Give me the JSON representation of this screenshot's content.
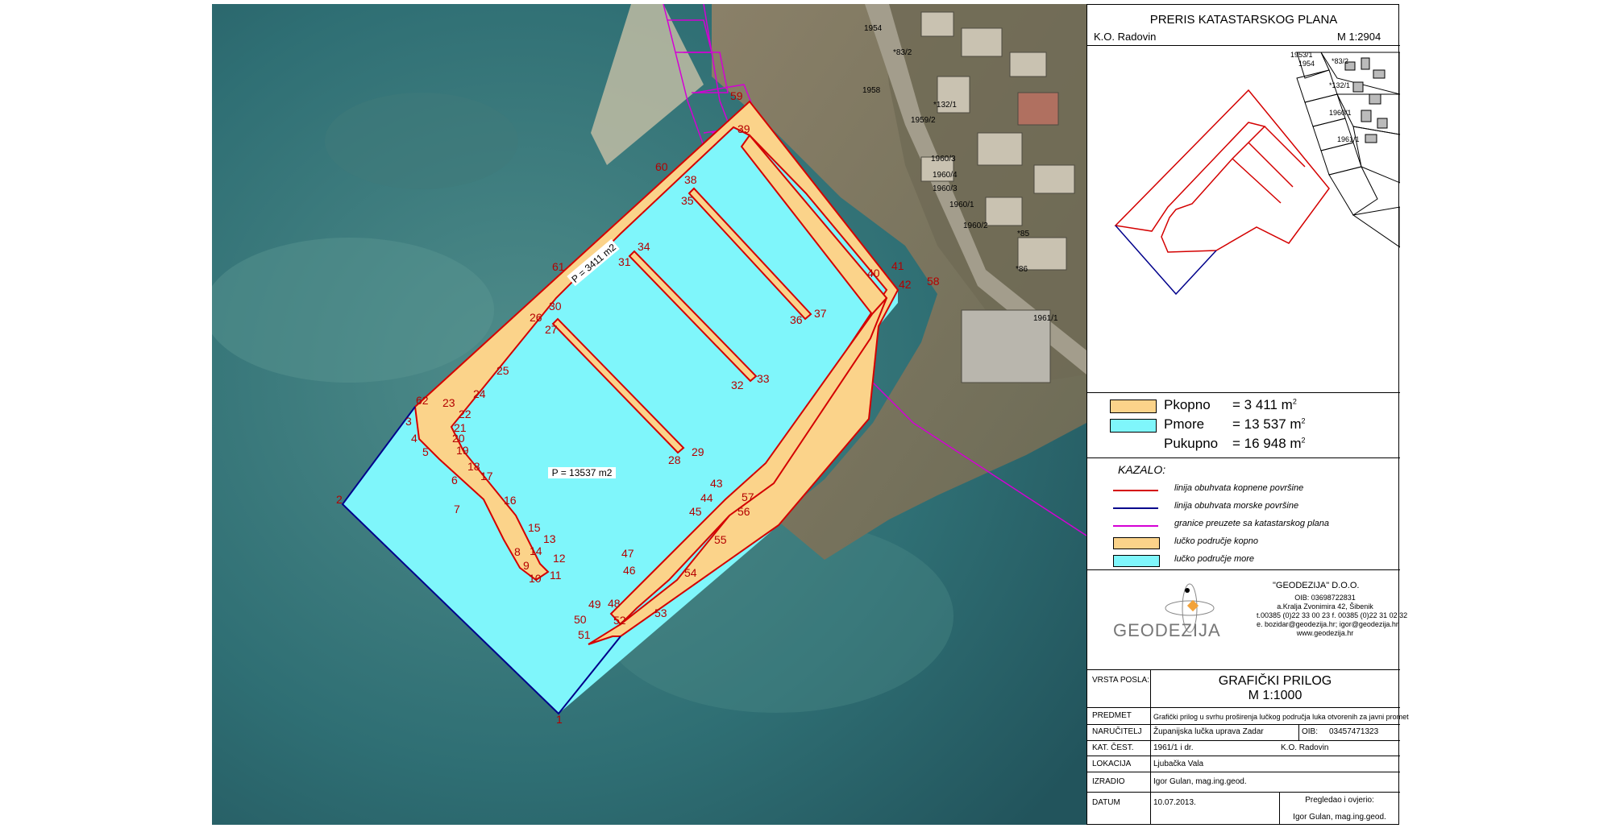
{
  "header": {
    "title": "PRERIS KATASTARSKOG PLANA",
    "ko": "K.O. Radovin",
    "scale": "M 1:2904"
  },
  "areas": [
    {
      "label": "Pkopno",
      "value": "=  3 411 m",
      "sup": "2",
      "color": "#fbd38a"
    },
    {
      "label": "Pmore",
      "value": "= 13 537 m",
      "sup": "2",
      "color": "#7ff6fb"
    },
    {
      "label": "Pukupno",
      "value": "= 16 948 m",
      "sup": "2"
    }
  ],
  "legend": {
    "title": "KAZALO:",
    "items": [
      {
        "kind": "line",
        "color": "#d40000",
        "label": "linija obuhvata kopnene površine"
      },
      {
        "kind": "line",
        "color": "#00008b",
        "label": "linija obuhvata morske površine"
      },
      {
        "kind": "line",
        "color": "#d400d4",
        "label": "granice preuzete sa katastarskog plana"
      },
      {
        "kind": "box",
        "color": "#fbd38a",
        "label": "lučko područje kopno"
      },
      {
        "kind": "box",
        "color": "#7ff6fb",
        "label": "lučko područje more"
      }
    ]
  },
  "company": {
    "logo_text": "GEODEZIJA",
    "name": "\"GEODEZIJA\" D.O.O.",
    "lines": [
      "OIB: 03698722831",
      "a.Kralja Zvonimira 42, Šibenik",
      "t.00385 (0)22 33 00 23 f. 00385 (0)22 31 02 32",
      "e. bozidar@geodezija.hr; igor@geodezija.hr",
      "www.geodezija.hr"
    ]
  },
  "titleblock": {
    "vrsta_label": "VRSTA POSLA:",
    "vrsta_title": "GRAFIČKI PRILOG",
    "vrsta_scale": "M 1:1000",
    "predmet_label": "PREDMET",
    "predmet_value": "Grafički prilog u svrhu proširenja lučkog područja luka otvorenih za javni promet",
    "narucitelj_label": "NARUČITELJ",
    "narucitelj_value": "Županijska lučka uprava Zadar",
    "oib_label": "OIB:",
    "oib_value": "03457471323",
    "katcest_label": "KAT. ČEST.",
    "katcest_value": "1961/1 i dr.",
    "ko_value": "K.O. Radovin",
    "lokacija_label": "LOKACIJA",
    "lokacija_value": "Ljubačka Vala",
    "izradio_label": "IZRADIO",
    "izradio_value": "Igor Gulan, mag.ing.geod.",
    "datum_label": "DATUM",
    "datum_value": "10.07.2013.",
    "pregledao_label": "Pregledao i ovjerio:",
    "pregledao_value": "Igor Gulan, mag.ing.geod."
  },
  "map": {
    "area_land_label": "P = 3411 m2",
    "area_sea_label": "P = 13537 m2",
    "points": [
      "1",
      "2",
      "3",
      "4",
      "5",
      "6",
      "7",
      "8",
      "9",
      "10",
      "11",
      "12",
      "13",
      "14",
      "15",
      "16",
      "17",
      "18",
      "19",
      "20",
      "21",
      "22",
      "23",
      "24",
      "25",
      "26",
      "27",
      "28",
      "29",
      "30",
      "31",
      "32",
      "33",
      "34",
      "35",
      "36",
      "37",
      "38",
      "39",
      "40",
      "41",
      "42",
      "43",
      "44",
      "45",
      "46",
      "47",
      "48",
      "49",
      "50",
      "51",
      "52",
      "53",
      "54",
      "55",
      "56",
      "57",
      "58",
      "59",
      "60",
      "61",
      "62"
    ],
    "parcels": [
      "1954",
      "*83/2",
      "1958",
      "*132/1",
      "1959/2",
      "1960/3",
      "1960/4",
      "1960/3",
      "1960/1",
      "1960/2",
      "*85",
      "*86",
      "1961/1"
    ],
    "minimap_parcels": [
      "1953/1",
      "1954",
      "*83/2",
      "*132/1",
      "1960/1",
      "1961/1"
    ]
  }
}
